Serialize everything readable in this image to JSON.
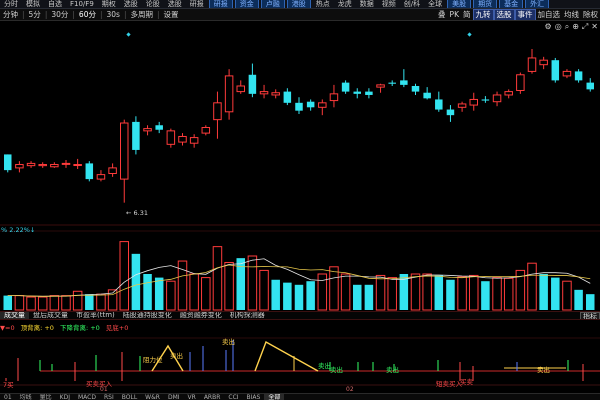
{
  "topbar": {
    "items": [
      "分时",
      "模拟",
      "自选",
      "F10/F9",
      "期权",
      "选股",
      "论股",
      "选股",
      "研报"
    ],
    "right_items": [
      "热点",
      "龙虎",
      "数据",
      "视频",
      "创/科",
      "全球"
    ],
    "tabs": [
      "研报",
      "资金",
      "卢融",
      "港股",
      "美股",
      "期货",
      "基金",
      "外汇"
    ]
  },
  "toolbar": {
    "periods": [
      "分钟",
      "5分",
      "30分",
      "60分",
      "30s",
      "多周期",
      "设置"
    ],
    "active_period": "60分",
    "right_buttons": [
      "叠",
      "PK",
      "简",
      "九转",
      "选股",
      "事件",
      "加自选",
      "均线",
      "除权"
    ],
    "highlight_buttons": [
      "九转",
      "选股",
      "事件"
    ]
  },
  "icons": [
    "gear-icon",
    "settings-icon",
    "search-icon",
    "zoom-icon",
    "restore-icon",
    "close-icon"
  ],
  "price_chart": {
    "low_label": "← 6.31",
    "pct_label": "% 2.22%↓",
    "colors": {
      "up": "#ff3b3b",
      "down": "#33e4f0",
      "bg": "#000000",
      "grid": "#3a0c0c"
    }
  },
  "candles": [
    {
      "o": 6.74,
      "h": 6.74,
      "l": 6.58,
      "c": 6.6
    },
    {
      "o": 6.62,
      "h": 6.68,
      "l": 6.58,
      "c": 6.65
    },
    {
      "o": 6.64,
      "h": 6.68,
      "l": 6.62,
      "c": 6.66
    },
    {
      "o": 6.64,
      "h": 6.67,
      "l": 6.62,
      "c": 6.65
    },
    {
      "o": 6.63,
      "h": 6.67,
      "l": 6.62,
      "c": 6.65
    },
    {
      "o": 6.66,
      "h": 6.69,
      "l": 6.62,
      "c": 6.66
    },
    {
      "o": 6.65,
      "h": 6.7,
      "l": 6.61,
      "c": 6.65
    },
    {
      "o": 6.66,
      "h": 6.68,
      "l": 6.5,
      "c": 6.52
    },
    {
      "o": 6.52,
      "h": 6.6,
      "l": 6.5,
      "c": 6.56
    },
    {
      "o": 6.57,
      "h": 6.66,
      "l": 6.54,
      "c": 6.62
    },
    {
      "o": 6.52,
      "h": 7.05,
      "l": 6.31,
      "c": 7.02
    },
    {
      "o": 7.03,
      "h": 7.08,
      "l": 6.74,
      "c": 6.78
    },
    {
      "o": 6.95,
      "h": 7.0,
      "l": 6.91,
      "c": 6.97
    },
    {
      "o": 7.0,
      "h": 7.03,
      "l": 6.93,
      "c": 6.96
    },
    {
      "o": 6.83,
      "h": 6.97,
      "l": 6.8,
      "c": 6.95
    },
    {
      "o": 6.85,
      "h": 6.93,
      "l": 6.82,
      "c": 6.9
    },
    {
      "o": 6.84,
      "h": 6.92,
      "l": 6.8,
      "c": 6.89
    },
    {
      "o": 6.93,
      "h": 7.0,
      "l": 6.91,
      "c": 6.98
    },
    {
      "o": 7.05,
      "h": 7.3,
      "l": 6.88,
      "c": 7.2
    },
    {
      "o": 7.12,
      "h": 7.5,
      "l": 7.05,
      "c": 7.44
    },
    {
      "o": 7.3,
      "h": 7.4,
      "l": 7.28,
      "c": 7.35
    },
    {
      "o": 7.45,
      "h": 7.55,
      "l": 7.25,
      "c": 7.28
    },
    {
      "o": 7.28,
      "h": 7.36,
      "l": 7.24,
      "c": 7.3
    },
    {
      "o": 7.27,
      "h": 7.32,
      "l": 7.24,
      "c": 7.29
    },
    {
      "o": 7.3,
      "h": 7.33,
      "l": 7.18,
      "c": 7.2
    },
    {
      "o": 7.2,
      "h": 7.25,
      "l": 7.1,
      "c": 7.13
    },
    {
      "o": 7.21,
      "h": 7.23,
      "l": 7.13,
      "c": 7.16
    },
    {
      "o": 7.16,
      "h": 7.23,
      "l": 7.09,
      "c": 7.2
    },
    {
      "o": 7.22,
      "h": 7.36,
      "l": 7.16,
      "c": 7.28
    },
    {
      "o": 7.38,
      "h": 7.4,
      "l": 7.28,
      "c": 7.3
    },
    {
      "o": 7.3,
      "h": 7.33,
      "l": 7.24,
      "c": 7.28
    },
    {
      "o": 7.3,
      "h": 7.33,
      "l": 7.24,
      "c": 7.27
    },
    {
      "o": 7.34,
      "h": 7.37,
      "l": 7.29,
      "c": 7.36
    },
    {
      "o": 7.38,
      "h": 7.4,
      "l": 7.35,
      "c": 7.37
    },
    {
      "o": 7.4,
      "h": 7.5,
      "l": 7.34,
      "c": 7.36
    },
    {
      "o": 7.35,
      "h": 7.37,
      "l": 7.27,
      "c": 7.3
    },
    {
      "o": 7.29,
      "h": 7.34,
      "l": 7.23,
      "c": 7.24
    },
    {
      "o": 7.23,
      "h": 7.3,
      "l": 7.12,
      "c": 7.14
    },
    {
      "o": 7.14,
      "h": 7.18,
      "l": 7.03,
      "c": 7.09
    },
    {
      "o": 7.16,
      "h": 7.21,
      "l": 7.12,
      "c": 7.19
    },
    {
      "o": 7.18,
      "h": 7.29,
      "l": 7.13,
      "c": 7.23
    },
    {
      "o": 7.23,
      "h": 7.26,
      "l": 7.2,
      "c": 7.22
    },
    {
      "o": 7.21,
      "h": 7.3,
      "l": 7.17,
      "c": 7.27
    },
    {
      "o": 7.27,
      "h": 7.32,
      "l": 7.24,
      "c": 7.3
    },
    {
      "o": 7.31,
      "h": 7.47,
      "l": 7.28,
      "c": 7.45
    },
    {
      "o": 7.48,
      "h": 7.68,
      "l": 7.46,
      "c": 7.6
    },
    {
      "o": 7.54,
      "h": 7.61,
      "l": 7.5,
      "c": 7.58
    },
    {
      "o": 7.58,
      "h": 7.6,
      "l": 7.38,
      "c": 7.4
    },
    {
      "o": 7.44,
      "h": 7.5,
      "l": 7.42,
      "c": 7.48
    },
    {
      "o": 7.48,
      "h": 7.5,
      "l": 7.38,
      "c": 7.4
    },
    {
      "o": 7.38,
      "h": 7.42,
      "l": 7.3,
      "c": 7.32
    }
  ],
  "volumes": [
    {
      "v": 0.2,
      "up": false
    },
    {
      "v": 0.2,
      "up": true
    },
    {
      "v": 0.18,
      "up": true
    },
    {
      "v": 0.18,
      "up": true
    },
    {
      "v": 0.2,
      "up": true
    },
    {
      "v": 0.2,
      "up": true
    },
    {
      "v": 0.26,
      "up": true
    },
    {
      "v": 0.22,
      "up": false
    },
    {
      "v": 0.22,
      "up": true
    },
    {
      "v": 0.28,
      "up": true
    },
    {
      "v": 0.95,
      "up": true
    },
    {
      "v": 0.78,
      "up": false
    },
    {
      "v": 0.5,
      "up": false
    },
    {
      "v": 0.45,
      "up": false
    },
    {
      "v": 0.4,
      "up": true
    },
    {
      "v": 0.68,
      "up": true
    },
    {
      "v": 0.5,
      "up": true
    },
    {
      "v": 0.45,
      "up": true
    },
    {
      "v": 0.88,
      "up": true
    },
    {
      "v": 0.66,
      "up": true
    },
    {
      "v": 0.72,
      "up": false
    },
    {
      "v": 0.75,
      "up": true
    },
    {
      "v": 0.55,
      "up": true
    },
    {
      "v": 0.42,
      "up": false
    },
    {
      "v": 0.38,
      "up": false
    },
    {
      "v": 0.35,
      "up": false
    },
    {
      "v": 0.4,
      "up": false
    },
    {
      "v": 0.5,
      "up": true
    },
    {
      "v": 0.6,
      "up": true
    },
    {
      "v": 0.5,
      "up": true
    },
    {
      "v": 0.35,
      "up": false
    },
    {
      "v": 0.35,
      "up": false
    },
    {
      "v": 0.48,
      "up": true
    },
    {
      "v": 0.45,
      "up": true
    },
    {
      "v": 0.5,
      "up": false
    },
    {
      "v": 0.5,
      "up": true
    },
    {
      "v": 0.5,
      "up": true
    },
    {
      "v": 0.48,
      "up": false
    },
    {
      "v": 0.42,
      "up": false
    },
    {
      "v": 0.46,
      "up": true
    },
    {
      "v": 0.48,
      "up": true
    },
    {
      "v": 0.4,
      "up": false
    },
    {
      "v": 0.45,
      "up": true
    },
    {
      "v": 0.44,
      "up": true
    },
    {
      "v": 0.55,
      "up": true
    },
    {
      "v": 0.65,
      "up": true
    },
    {
      "v": 0.5,
      "up": false
    },
    {
      "v": 0.45,
      "up": false
    },
    {
      "v": 0.4,
      "up": true
    },
    {
      "v": 0.28,
      "up": false
    },
    {
      "v": 0.22,
      "up": false
    }
  ],
  "volume_row": {
    "items": [
      "成交量",
      "盘后成交量",
      "市盈率(ttm)",
      "陆股通持股变化",
      "融资融券变化",
      "机构探测器"
    ],
    "right": "指标"
  },
  "indicator_row": [
    {
      "text": "▼=0",
      "color": "#ff4a4a"
    },
    {
      "text": "顶背离: +0",
      "color": "#ffdd33"
    },
    {
      "text": "下降背离: +0",
      "color": "#33ff66"
    },
    {
      "text": "见底+0",
      "color": "#ff4a4a"
    }
  ],
  "indicator_labels": [
    {
      "text": "阻力位",
      "color": "#ffd24d"
    },
    {
      "text": "卖出",
      "color": "#ffd24d"
    },
    {
      "text": "卖出",
      "color": "#ffd24d"
    },
    {
      "text": "卖出",
      "color": "#33ff66"
    },
    {
      "text": "卖出",
      "color": "#33ff66"
    },
    {
      "text": "卖出",
      "color": "#33ff66"
    },
    {
      "text": "卖出",
      "color": "#ffd24d"
    },
    {
      "text": "买卖买入",
      "color": "#ff4a4a"
    },
    {
      "text": "短卖买入",
      "color": "#ff4a4a"
    },
    {
      "text": "买卖",
      "color": "#ff4a4a"
    },
    {
      "text": "7买",
      "color": "#ff4a4a"
    }
  ],
  "date_labels": [
    "01",
    "02"
  ],
  "bottombar": {
    "items": [
      "01",
      "均线",
      "量比",
      "KDJ",
      "MACD",
      "RSI",
      "BOLL",
      "W&R",
      "DMI",
      "VR",
      "ARBR",
      "CCI",
      "BIAS",
      "全部"
    ]
  }
}
